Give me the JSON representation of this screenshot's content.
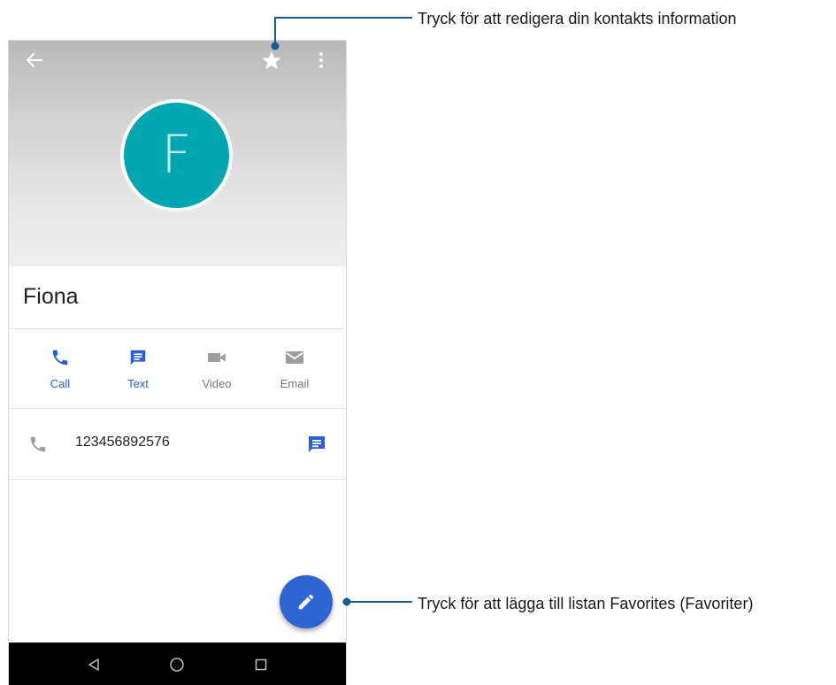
{
  "contact": {
    "avatar_letter": "F",
    "name": "Fiona",
    "phone_number": "123456892576"
  },
  "actions": [
    {
      "label": "Call",
      "icon": "phone-icon",
      "active": true
    },
    {
      "label": "Text",
      "icon": "message-icon",
      "active": true
    },
    {
      "label": "Video",
      "icon": "video-icon",
      "active": false
    },
    {
      "label": "Email",
      "icon": "email-icon",
      "active": false
    }
  ],
  "toolbar": {
    "back_icon": "back-arrow-icon",
    "favorite_icon": "star-icon",
    "more_icon": "more-vert-icon"
  },
  "fab": {
    "icon": "edit-pencil-icon"
  },
  "navbar": {
    "back_icon": "nav-back-icon",
    "home_icon": "nav-home-icon",
    "recent_icon": "nav-recent-icon"
  },
  "annotations": {
    "star_callout": "Tryck för att redigera din kontakts information",
    "fab_callout": "Tryck för att lägga till listan Favorites (Favoriter)"
  },
  "colors": {
    "accent": "#2f64d3",
    "avatar_bg": "#00a6b0",
    "active_label": "#2c5fcf",
    "inactive_icon": "#9e9e9e",
    "callout_line": "#1f5a8c"
  }
}
